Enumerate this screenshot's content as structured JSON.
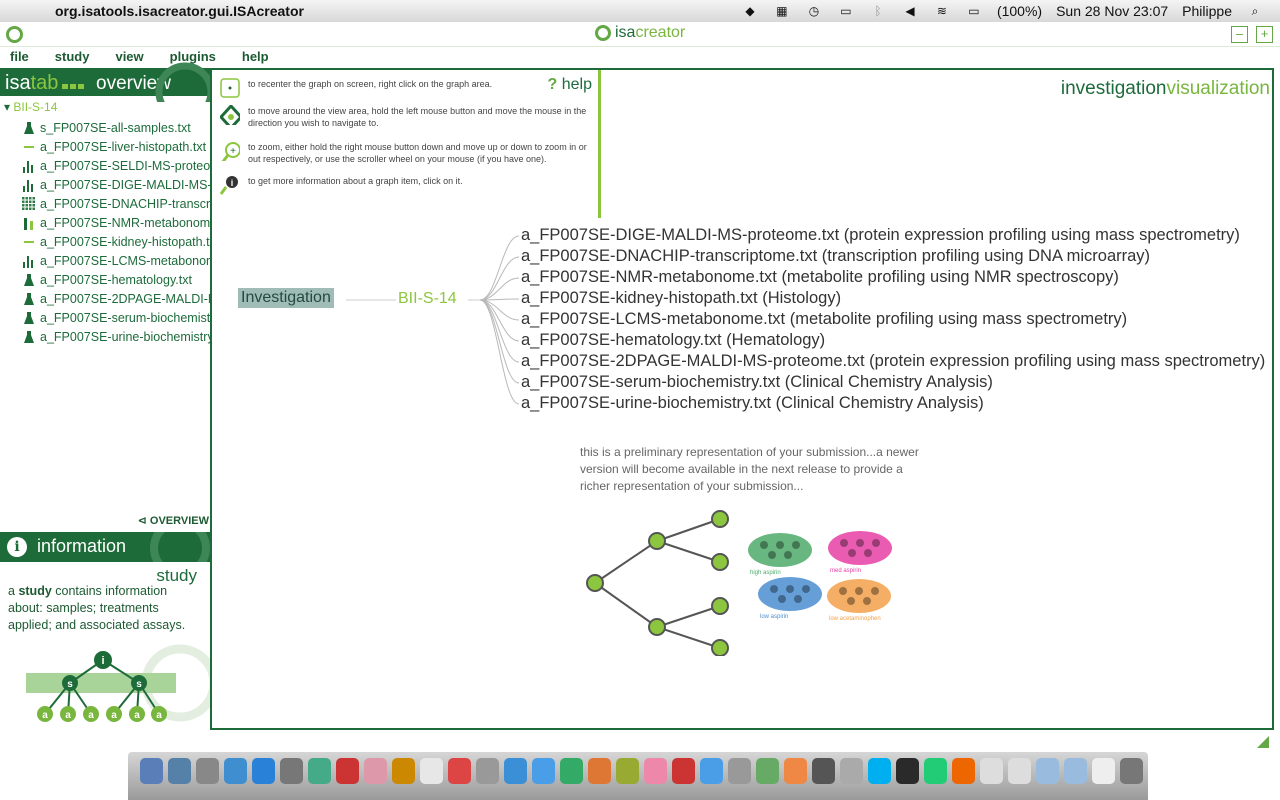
{
  "mac_menubar": {
    "app_name": "org.isatools.isacreator.gui.ISAcreator",
    "battery": "(100%)",
    "datetime": "Sun 28 Nov  23:07",
    "user": "Philippe"
  },
  "app": {
    "brand_prefix": "isa",
    "brand_suffix": "creator"
  },
  "menu": [
    "file",
    "study",
    "view",
    "plugins",
    "help"
  ],
  "sidebar": {
    "header_isa": "isa",
    "header_tab": "tab",
    "header_overview": "overview",
    "root": "BII-S-14",
    "items": [
      {
        "label": "s_FP007SE-all-samples.txt",
        "icon": "flask-icon"
      },
      {
        "label": "a_FP007SE-liver-histopath.txt",
        "icon": "microscope-icon"
      },
      {
        "label": "a_FP007SE-SELDI-MS-proteome.txt",
        "icon": "bar-chart-icon"
      },
      {
        "label": "a_FP007SE-DIGE-MALDI-MS-proteome.txt",
        "icon": "bar-chart-icon"
      },
      {
        "label": "a_FP007SE-DNACHIP-transcriptome.txt",
        "icon": "microarray-icon"
      },
      {
        "label": "a_FP007SE-NMR-metabonome.txt",
        "icon": "nmr-icon"
      },
      {
        "label": "a_FP007SE-kidney-histopath.txt",
        "icon": "microscope-icon"
      },
      {
        "label": "a_FP007SE-LCMS-metabonome.txt",
        "icon": "bar-chart-icon"
      },
      {
        "label": "a_FP007SE-hematology.txt",
        "icon": "flask-icon"
      },
      {
        "label": "a_FP007SE-2DPAGE-MALDI-MS-proteome.txt",
        "icon": "flask-icon"
      },
      {
        "label": "a_FP007SE-serum-biochemistry.txt",
        "icon": "flask-icon"
      },
      {
        "label": "a_FP007SE-urine-biochemistry.txt",
        "icon": "flask-icon"
      }
    ],
    "overview_link": "OVERVIEW",
    "info_title": "information",
    "study_title": "study",
    "study_desc_pre": "a ",
    "study_desc_bold": "study",
    "study_desc_post": " contains information about: samples; treatments applied; and associated assays."
  },
  "help": {
    "title_q": "?",
    "title": "help",
    "rows": [
      "to recenter the graph on screen, right click on the graph area.",
      "to move around the view area, hold the left mouse button and move the mouse in the direction you wish to navigate to.",
      "to zoom, either hold the right mouse button down and move up or down to zoom in or out respectively, or use the scroller wheel on your mouse (if you have one).",
      "to get more information about a graph item, click on it."
    ]
  },
  "viz": {
    "title_a": "investigation",
    "title_b": "visualization",
    "investigation_node": "Investigation",
    "study_node": "BII-S-14",
    "assays": [
      "a_FP007SE-DIGE-MALDI-MS-proteome.txt (protein expression profiling using mass spectrometry)",
      "a_FP007SE-DNACHIP-transcriptome.txt (transcription profiling using DNA microarray)",
      "a_FP007SE-NMR-metabonome.txt (metabolite profiling using NMR spectroscopy)",
      "a_FP007SE-kidney-histopath.txt (Histology)",
      "a_FP007SE-LCMS-metabonome.txt (metabolite profiling using mass spectrometry)",
      "a_FP007SE-hematology.txt (Hematology)",
      "a_FP007SE-2DPAGE-MALDI-MS-proteome.txt (protein expression profiling using mass spectrometry)",
      "a_FP007SE-serum-biochemistry.txt (Clinical Chemistry Analysis)",
      "a_FP007SE-urine-biochemistry.txt (Clinical Chemistry Analysis)"
    ],
    "prelim_text": "this is a preliminary representation of your submission...a newer version will become available in the next release to provide a richer representation of your submission...",
    "groups": [
      {
        "label": "high aspirin",
        "color": "#4daa6a"
      },
      {
        "label": "med aspirin",
        "color": "#e63fa5"
      },
      {
        "label": "low aspirin",
        "color": "#4b8ed0"
      },
      {
        "label": "low acetaminophen",
        "color": "#f3a04a"
      }
    ]
  },
  "colors": {
    "dark_green": "#1e6b3a",
    "light_green": "#8cc63e"
  }
}
